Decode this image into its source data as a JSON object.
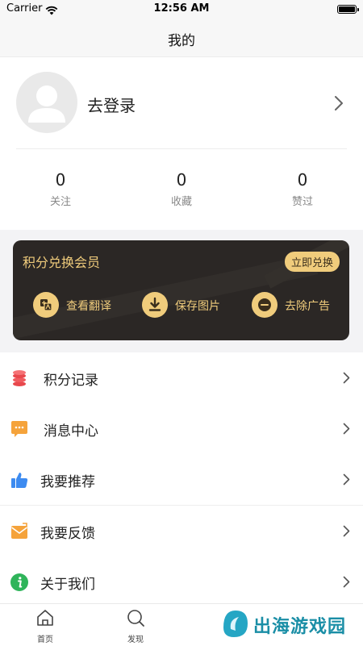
{
  "status_bar": {
    "carrier": "Carrier",
    "time": "12:56 AM"
  },
  "nav": {
    "title": "我的"
  },
  "profile": {
    "login_label": "去登录",
    "stats": [
      {
        "count": "0",
        "label": "关注"
      },
      {
        "count": "0",
        "label": "收藏"
      },
      {
        "count": "0",
        "label": "赞过"
      }
    ]
  },
  "vip_card": {
    "title": "积分兑换会员",
    "redeem_label": "立即兑换",
    "features": [
      {
        "label": "查看翻译",
        "icon": "translate-icon"
      },
      {
        "label": "保存图片",
        "icon": "download-icon"
      },
      {
        "label": "去除广告",
        "icon": "remove-ad-icon"
      }
    ],
    "accent_color": "#f0cc7c",
    "background_color": "#2b2725"
  },
  "menu": [
    {
      "label": "积分记录",
      "icon": "coins-icon"
    },
    {
      "label": "消息中心",
      "icon": "message-icon"
    },
    {
      "label": "我要推荐",
      "icon": "thumbs-up-icon"
    },
    {
      "label": "我要反馈",
      "icon": "feedback-mail-icon"
    },
    {
      "label": "关于我们",
      "icon": "info-icon"
    }
  ],
  "tabbar": {
    "tabs": [
      {
        "label": "首页",
        "icon": "home-icon"
      },
      {
        "label": "发现",
        "icon": "discover-icon"
      }
    ]
  },
  "watermark": {
    "text": "出海游戏园"
  }
}
